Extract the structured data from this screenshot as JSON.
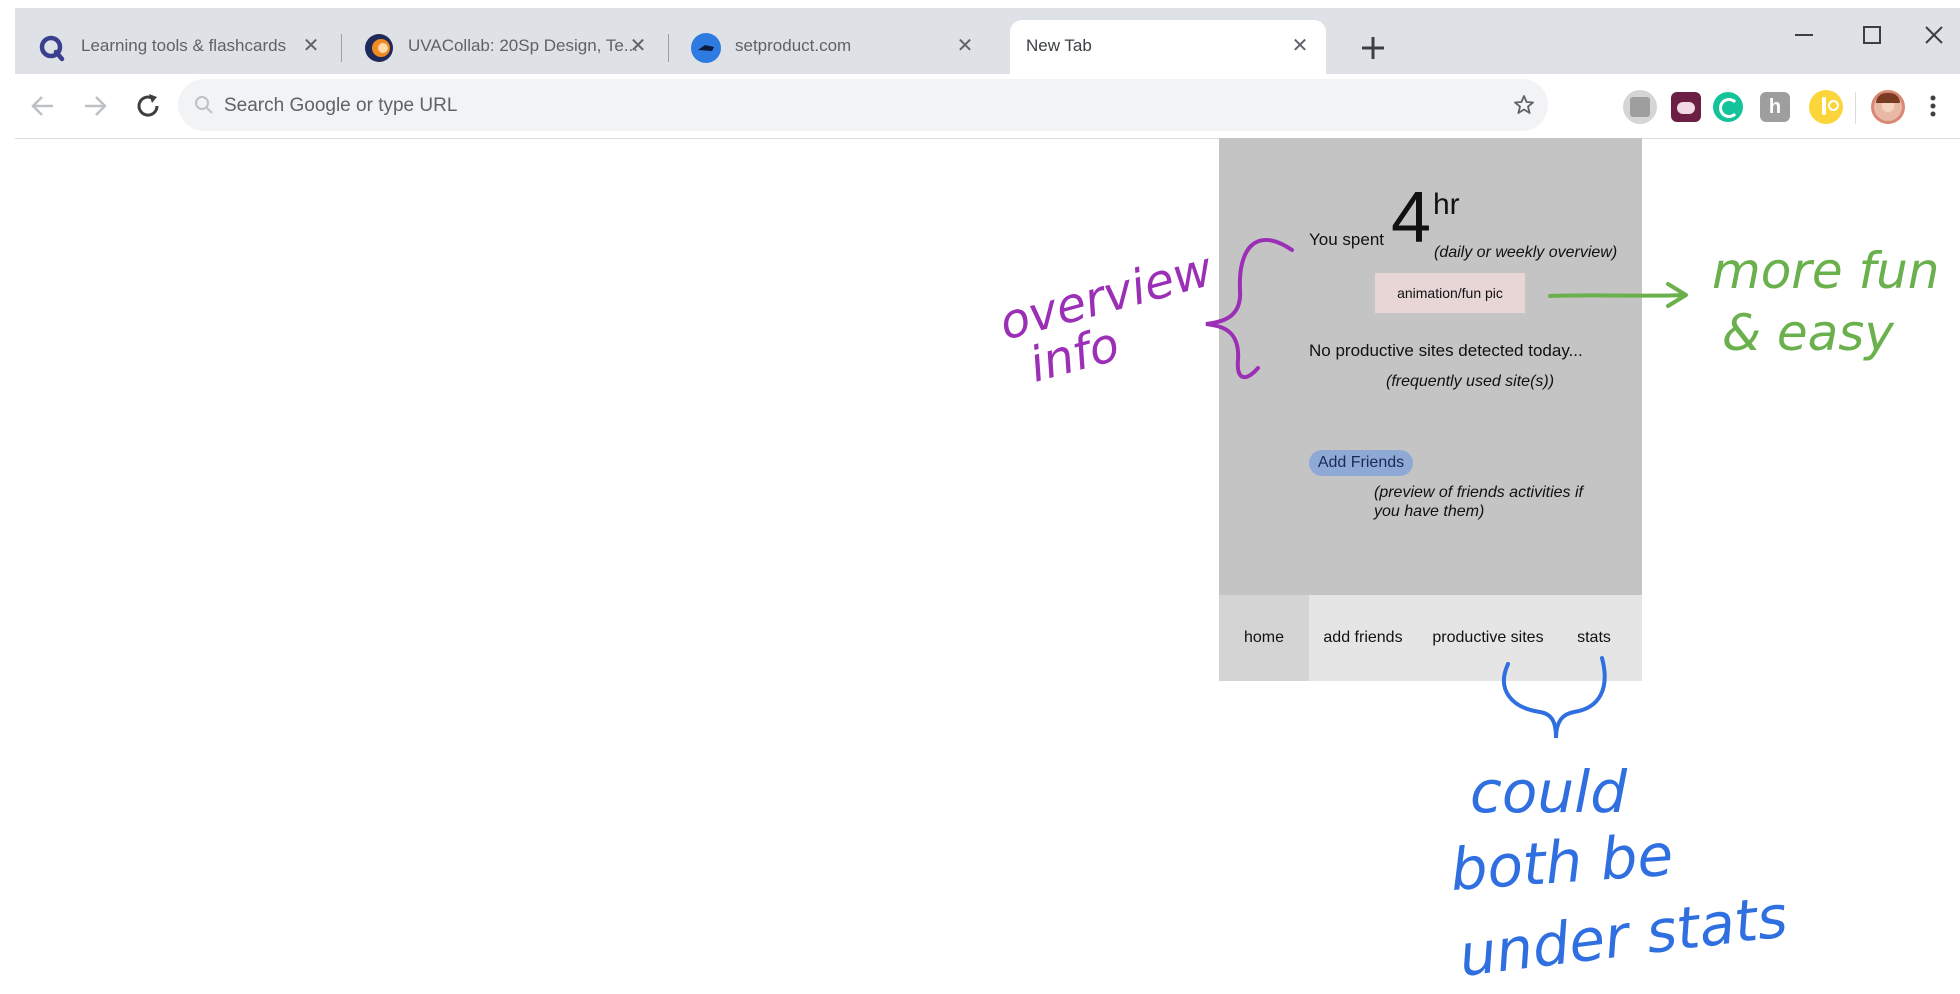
{
  "browser": {
    "tabs": [
      {
        "title": "Learning tools & flashcards",
        "icon": "quizlet-icon",
        "active": false
      },
      {
        "title": "UVACollab: 20Sp Design, Te...",
        "icon": "uvacollab-icon",
        "active": false
      },
      {
        "title": "setproduct.com",
        "icon": "setproduct-icon",
        "active": false
      },
      {
        "title": "New Tab",
        "icon": "",
        "active": true
      }
    ],
    "omnibox_placeholder": "Search Google or type URL",
    "extensions": [
      "extension-gray-icon",
      "extension-face-icon",
      "grammarly-icon",
      "extension-h-icon",
      "extension-yellow-icon",
      "profile-avatar"
    ]
  },
  "popup": {
    "spent_label": "You spent",
    "spent_value": "4",
    "spent_unit": "hr",
    "overview_note": "(daily or weekly overview)",
    "animation_placeholder": "animation/fun pic",
    "no_sites": "No productive sites detected today...",
    "frequent_note": "(frequently used site(s))",
    "add_friends_button": "Add Friends",
    "friends_note": "(preview of friends activities if you have them)",
    "nav": {
      "home": "home",
      "add_friends": "add friends",
      "productive_sites": "productive sites",
      "stats": "stats"
    }
  },
  "annotations": {
    "overview_line1": "overview",
    "overview_line2": "info",
    "fun_line1": "more fun",
    "fun_line2": "& easy",
    "stats_line1": "could",
    "stats_line2": "both be",
    "stats_line3": "under stats",
    "colors": {
      "purple": "#9b2fb5",
      "green": "#6ab04c",
      "blue": "#2f6fe0"
    }
  }
}
